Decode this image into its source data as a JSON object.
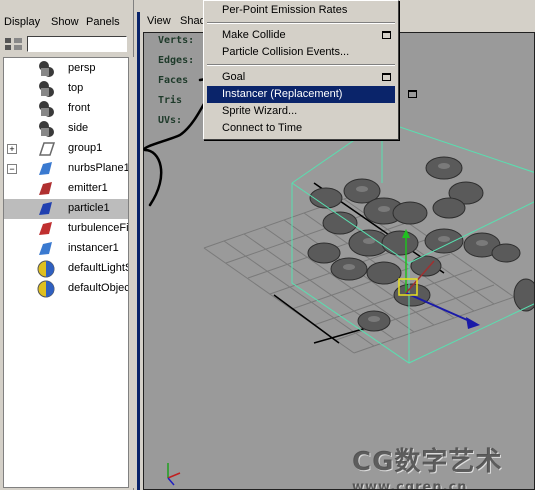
{
  "outliner": {
    "menu": [
      "Display",
      "Show",
      "Panels"
    ],
    "items": [
      {
        "label": "persp",
        "icon": "camera-icon",
        "expander": ""
      },
      {
        "label": "top",
        "icon": "camera-icon",
        "expander": ""
      },
      {
        "label": "front",
        "icon": "camera-icon",
        "expander": ""
      },
      {
        "label": "side",
        "icon": "camera-icon",
        "expander": ""
      },
      {
        "label": "group1",
        "icon": "group-icon",
        "expander": "+"
      },
      {
        "label": "nurbsPlane1",
        "icon": "nurbs-plane-icon",
        "expander": "−"
      },
      {
        "label": "emitter1",
        "icon": "emitter-icon",
        "expander": ""
      },
      {
        "label": "particle1",
        "icon": "particle-icon",
        "expander": "",
        "selected": true
      },
      {
        "label": "turbulenceFie",
        "icon": "turbulence-field-icon",
        "expander": ""
      },
      {
        "label": "instancer1",
        "icon": "instancer-icon",
        "expander": ""
      },
      {
        "label": "defaultLightS",
        "icon": "light-set-icon",
        "expander": ""
      },
      {
        "label": "defaultObjec",
        "icon": "object-set-icon",
        "expander": ""
      }
    ]
  },
  "viewport": {
    "menu": [
      "View",
      "Shad"
    ],
    "hud": [
      "Verts:",
      "Edges:",
      "Faces",
      "Tris",
      "UVs:"
    ]
  },
  "context_menu": {
    "items": [
      {
        "label": "Per-Point Emission Rates",
        "option_box": false
      },
      {
        "separator": true
      },
      {
        "label": "Make Collide",
        "option_box": true
      },
      {
        "label": "Particle Collision Events...",
        "option_box": false
      },
      {
        "separator": true
      },
      {
        "label": "Goal",
        "option_box": true
      },
      {
        "label": "Instancer (Replacement)",
        "option_box": true,
        "highlighted": true
      },
      {
        "label": "Sprite Wizard...",
        "option_box": false
      },
      {
        "label": "Connect to Time",
        "option_box": false
      }
    ]
  },
  "watermark": {
    "title": "CG数字艺术",
    "url": "www.cgren.cn"
  },
  "colors": {
    "highlight": "#0a246a",
    "bounding_box": "#58e0b0",
    "grid": "#7a7a7a"
  }
}
